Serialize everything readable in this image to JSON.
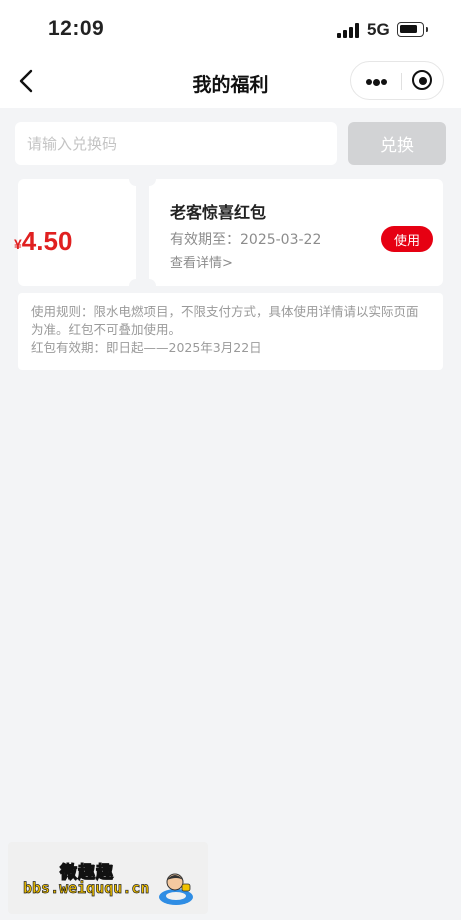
{
  "status_bar": {
    "time": "12:09",
    "network": "5G"
  },
  "nav": {
    "title": "我的福利"
  },
  "redeem": {
    "placeholder": "请输入兑换码",
    "button_label": "兑换"
  },
  "coupon": {
    "currency_symbol": "¥",
    "amount": "4.50",
    "title": "老客惊喜红包",
    "validity": "有效期至：2025-03-22",
    "detail_link": "查看详情>",
    "use_button": "使用",
    "accent_color": "#e60012"
  },
  "rules": {
    "line1": "使用规则：限水电燃项目，不限支付方式，具体使用详情请以实际页面为准。红包不可叠加使用。",
    "line2": "红包有效期：即日起——2025年3月22日"
  },
  "watermark": {
    "name": "微趣趣",
    "url": "bbs.weiququ.cn"
  },
  "icons": [
    "back-arrow-icon",
    "more-dots-icon",
    "close-target-icon",
    "signal-icon",
    "battery-icon"
  ]
}
